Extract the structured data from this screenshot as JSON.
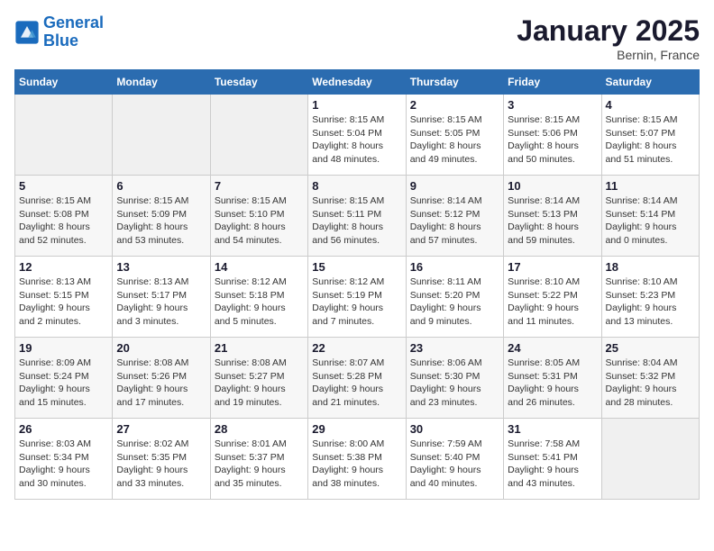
{
  "logo": {
    "line1": "General",
    "line2": "Blue"
  },
  "title": "January 2025",
  "subtitle": "Bernin, France",
  "days_header": [
    "Sunday",
    "Monday",
    "Tuesday",
    "Wednesday",
    "Thursday",
    "Friday",
    "Saturday"
  ],
  "weeks": [
    [
      {
        "day": "",
        "info": ""
      },
      {
        "day": "",
        "info": ""
      },
      {
        "day": "",
        "info": ""
      },
      {
        "day": "1",
        "info": "Sunrise: 8:15 AM\nSunset: 5:04 PM\nDaylight: 8 hours\nand 48 minutes."
      },
      {
        "day": "2",
        "info": "Sunrise: 8:15 AM\nSunset: 5:05 PM\nDaylight: 8 hours\nand 49 minutes."
      },
      {
        "day": "3",
        "info": "Sunrise: 8:15 AM\nSunset: 5:06 PM\nDaylight: 8 hours\nand 50 minutes."
      },
      {
        "day": "4",
        "info": "Sunrise: 8:15 AM\nSunset: 5:07 PM\nDaylight: 8 hours\nand 51 minutes."
      }
    ],
    [
      {
        "day": "5",
        "info": "Sunrise: 8:15 AM\nSunset: 5:08 PM\nDaylight: 8 hours\nand 52 minutes."
      },
      {
        "day": "6",
        "info": "Sunrise: 8:15 AM\nSunset: 5:09 PM\nDaylight: 8 hours\nand 53 minutes."
      },
      {
        "day": "7",
        "info": "Sunrise: 8:15 AM\nSunset: 5:10 PM\nDaylight: 8 hours\nand 54 minutes."
      },
      {
        "day": "8",
        "info": "Sunrise: 8:15 AM\nSunset: 5:11 PM\nDaylight: 8 hours\nand 56 minutes."
      },
      {
        "day": "9",
        "info": "Sunrise: 8:14 AM\nSunset: 5:12 PM\nDaylight: 8 hours\nand 57 minutes."
      },
      {
        "day": "10",
        "info": "Sunrise: 8:14 AM\nSunset: 5:13 PM\nDaylight: 8 hours\nand 59 minutes."
      },
      {
        "day": "11",
        "info": "Sunrise: 8:14 AM\nSunset: 5:14 PM\nDaylight: 9 hours\nand 0 minutes."
      }
    ],
    [
      {
        "day": "12",
        "info": "Sunrise: 8:13 AM\nSunset: 5:15 PM\nDaylight: 9 hours\nand 2 minutes."
      },
      {
        "day": "13",
        "info": "Sunrise: 8:13 AM\nSunset: 5:17 PM\nDaylight: 9 hours\nand 3 minutes."
      },
      {
        "day": "14",
        "info": "Sunrise: 8:12 AM\nSunset: 5:18 PM\nDaylight: 9 hours\nand 5 minutes."
      },
      {
        "day": "15",
        "info": "Sunrise: 8:12 AM\nSunset: 5:19 PM\nDaylight: 9 hours\nand 7 minutes."
      },
      {
        "day": "16",
        "info": "Sunrise: 8:11 AM\nSunset: 5:20 PM\nDaylight: 9 hours\nand 9 minutes."
      },
      {
        "day": "17",
        "info": "Sunrise: 8:10 AM\nSunset: 5:22 PM\nDaylight: 9 hours\nand 11 minutes."
      },
      {
        "day": "18",
        "info": "Sunrise: 8:10 AM\nSunset: 5:23 PM\nDaylight: 9 hours\nand 13 minutes."
      }
    ],
    [
      {
        "day": "19",
        "info": "Sunrise: 8:09 AM\nSunset: 5:24 PM\nDaylight: 9 hours\nand 15 minutes."
      },
      {
        "day": "20",
        "info": "Sunrise: 8:08 AM\nSunset: 5:26 PM\nDaylight: 9 hours\nand 17 minutes."
      },
      {
        "day": "21",
        "info": "Sunrise: 8:08 AM\nSunset: 5:27 PM\nDaylight: 9 hours\nand 19 minutes."
      },
      {
        "day": "22",
        "info": "Sunrise: 8:07 AM\nSunset: 5:28 PM\nDaylight: 9 hours\nand 21 minutes."
      },
      {
        "day": "23",
        "info": "Sunrise: 8:06 AM\nSunset: 5:30 PM\nDaylight: 9 hours\nand 23 minutes."
      },
      {
        "day": "24",
        "info": "Sunrise: 8:05 AM\nSunset: 5:31 PM\nDaylight: 9 hours\nand 26 minutes."
      },
      {
        "day": "25",
        "info": "Sunrise: 8:04 AM\nSunset: 5:32 PM\nDaylight: 9 hours\nand 28 minutes."
      }
    ],
    [
      {
        "day": "26",
        "info": "Sunrise: 8:03 AM\nSunset: 5:34 PM\nDaylight: 9 hours\nand 30 minutes."
      },
      {
        "day": "27",
        "info": "Sunrise: 8:02 AM\nSunset: 5:35 PM\nDaylight: 9 hours\nand 33 minutes."
      },
      {
        "day": "28",
        "info": "Sunrise: 8:01 AM\nSunset: 5:37 PM\nDaylight: 9 hours\nand 35 minutes."
      },
      {
        "day": "29",
        "info": "Sunrise: 8:00 AM\nSunset: 5:38 PM\nDaylight: 9 hours\nand 38 minutes."
      },
      {
        "day": "30",
        "info": "Sunrise: 7:59 AM\nSunset: 5:40 PM\nDaylight: 9 hours\nand 40 minutes."
      },
      {
        "day": "31",
        "info": "Sunrise: 7:58 AM\nSunset: 5:41 PM\nDaylight: 9 hours\nand 43 minutes."
      },
      {
        "day": "",
        "info": ""
      }
    ]
  ]
}
